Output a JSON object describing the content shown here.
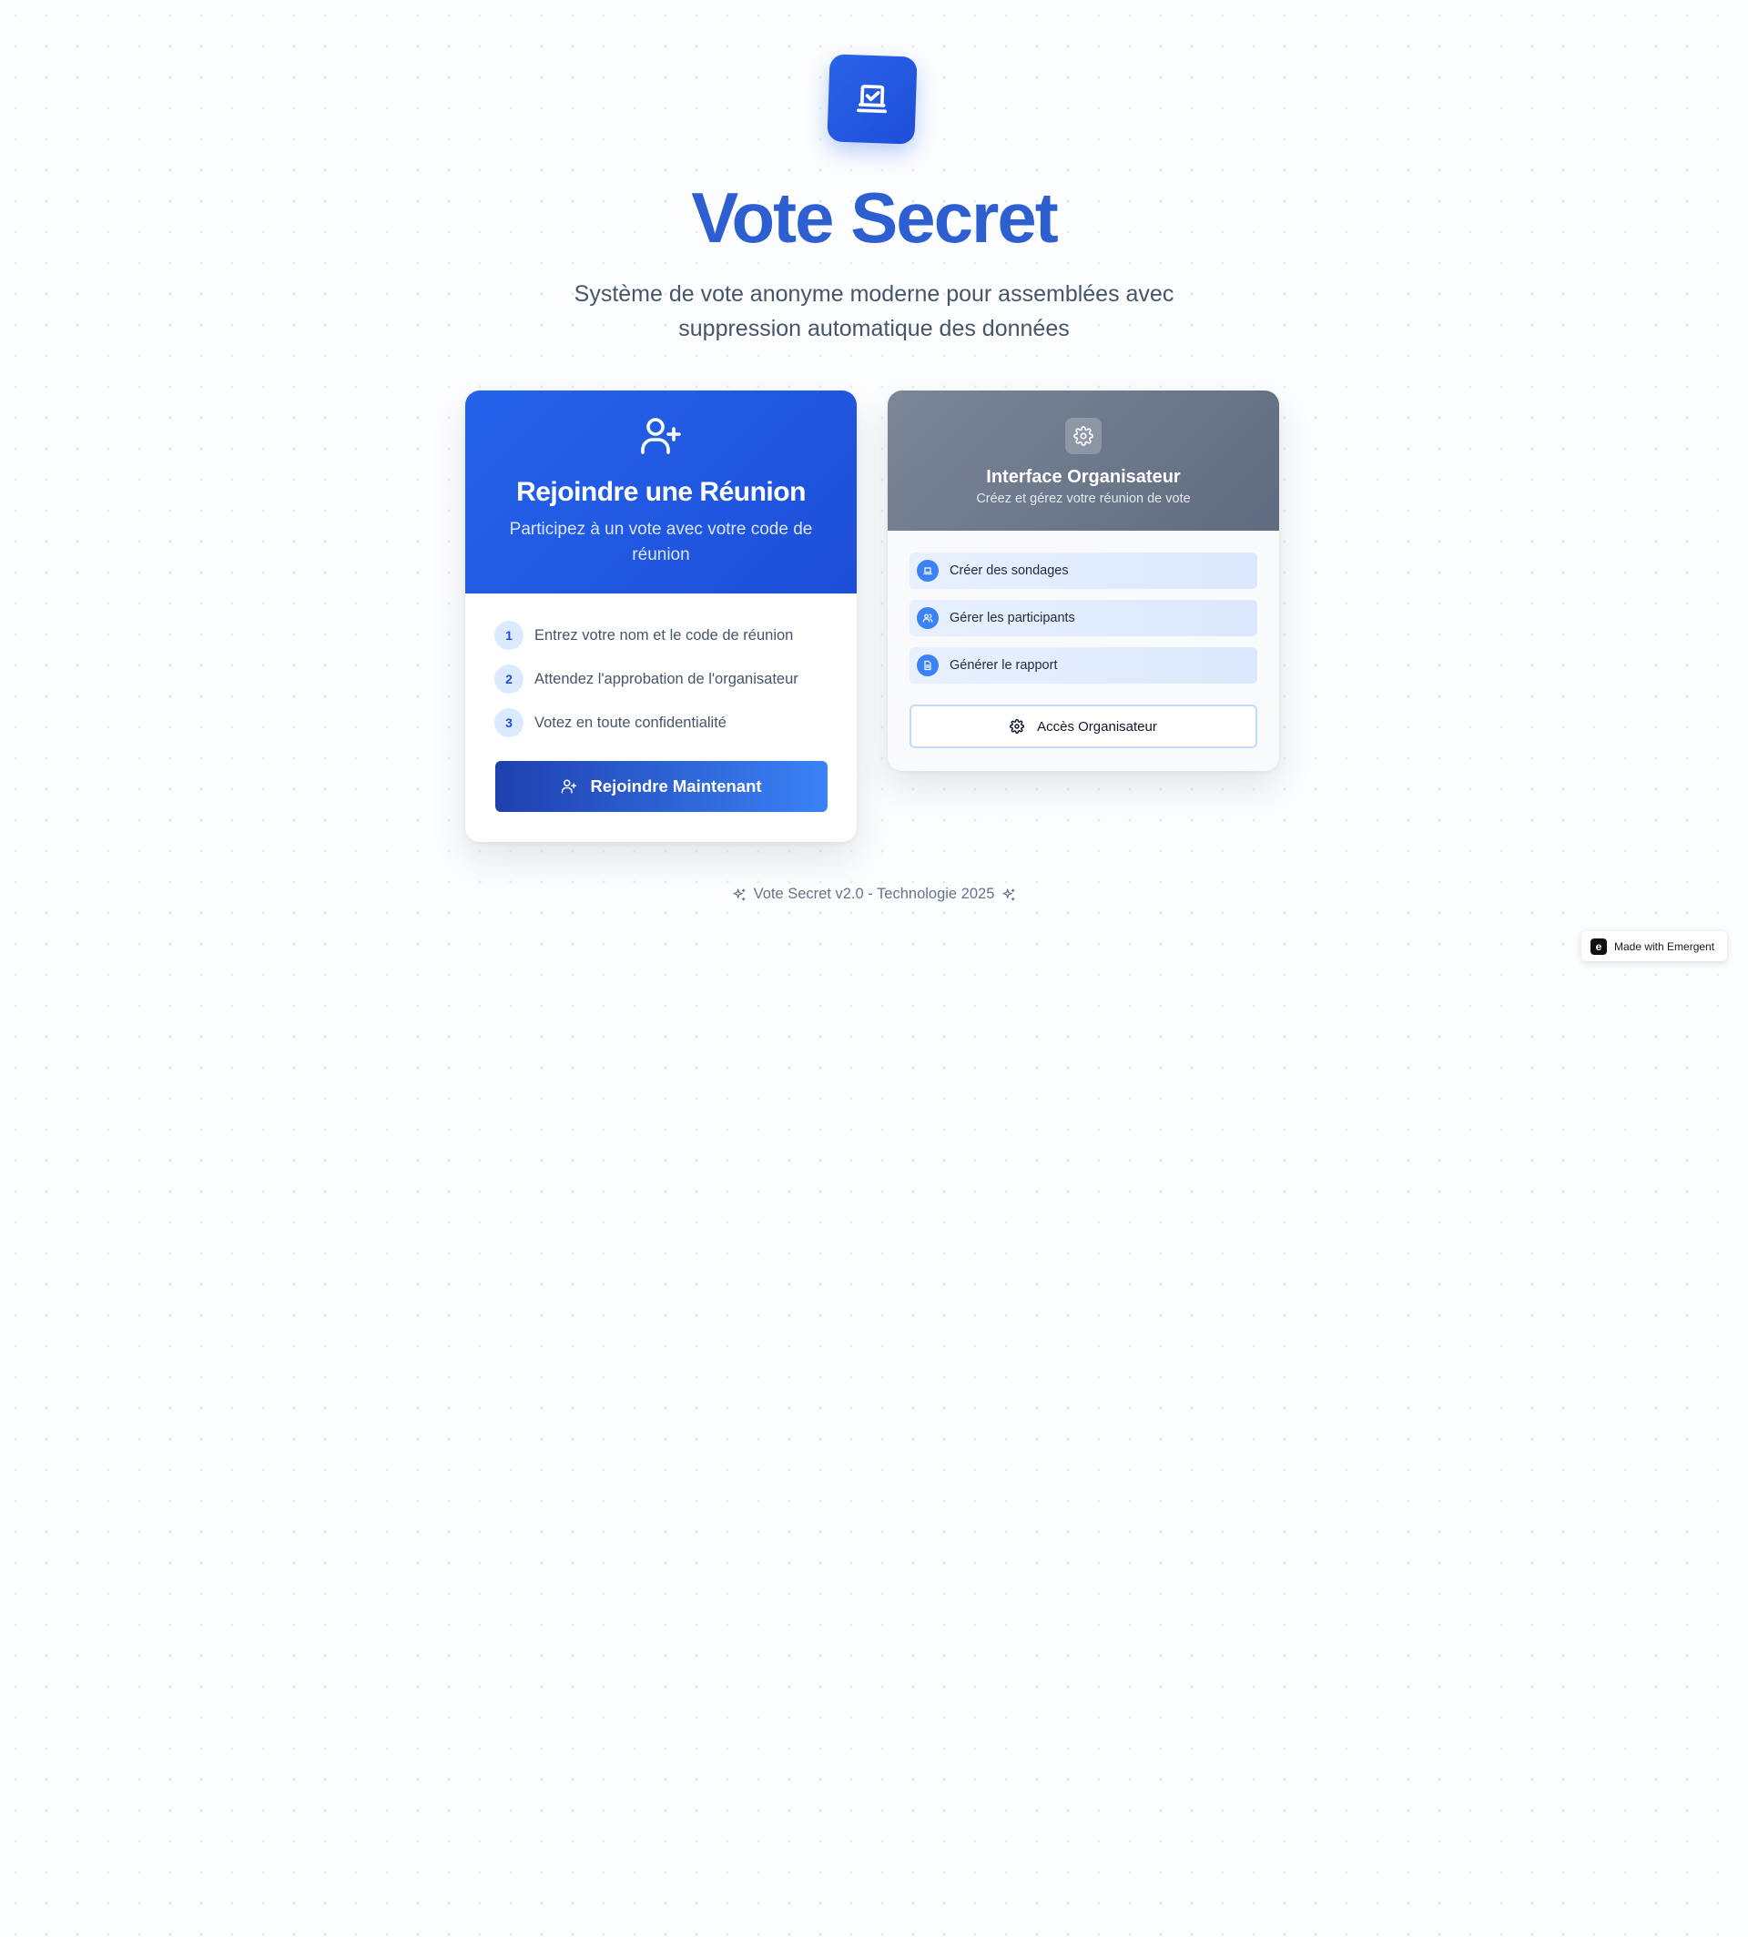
{
  "app": {
    "title": "Vote Secret",
    "subtitle_line1": "Système de vote anonyme moderne pour assemblées avec",
    "subtitle_line2": "suppression automatique des données",
    "logo_icon": "ballot-check-icon",
    "accent_color": "#2563eb"
  },
  "join_card": {
    "icon": "user-plus-icon",
    "title": "Rejoindre une Réunion",
    "subtitle": "Participez à un vote avec votre code de réunion",
    "steps": [
      {
        "number": "1",
        "text": "Entrez votre nom et le code de réunion"
      },
      {
        "number": "2",
        "text": "Attendez l'approbation de l'organisateur"
      },
      {
        "number": "3",
        "text": "Votez en toute confidentialité"
      }
    ],
    "button_label": "Rejoindre Maintenant"
  },
  "organizer_card": {
    "icon": "gear-icon",
    "title": "Interface Organisateur",
    "subtitle": "Créez et gérez votre réunion de vote",
    "features": [
      {
        "icon": "ballot-icon",
        "text": "Créer des sondages"
      },
      {
        "icon": "users-icon",
        "text": "Gérer les participants"
      },
      {
        "icon": "document-icon",
        "text": "Générer le rapport"
      }
    ],
    "button_label": "Accès Organisateur"
  },
  "footer": {
    "text": "Vote Secret v2.0 - Technologie 2025",
    "icon": "sparkles-icon"
  },
  "badge": {
    "text": "Made with Emergent",
    "logo_letter": "e"
  }
}
